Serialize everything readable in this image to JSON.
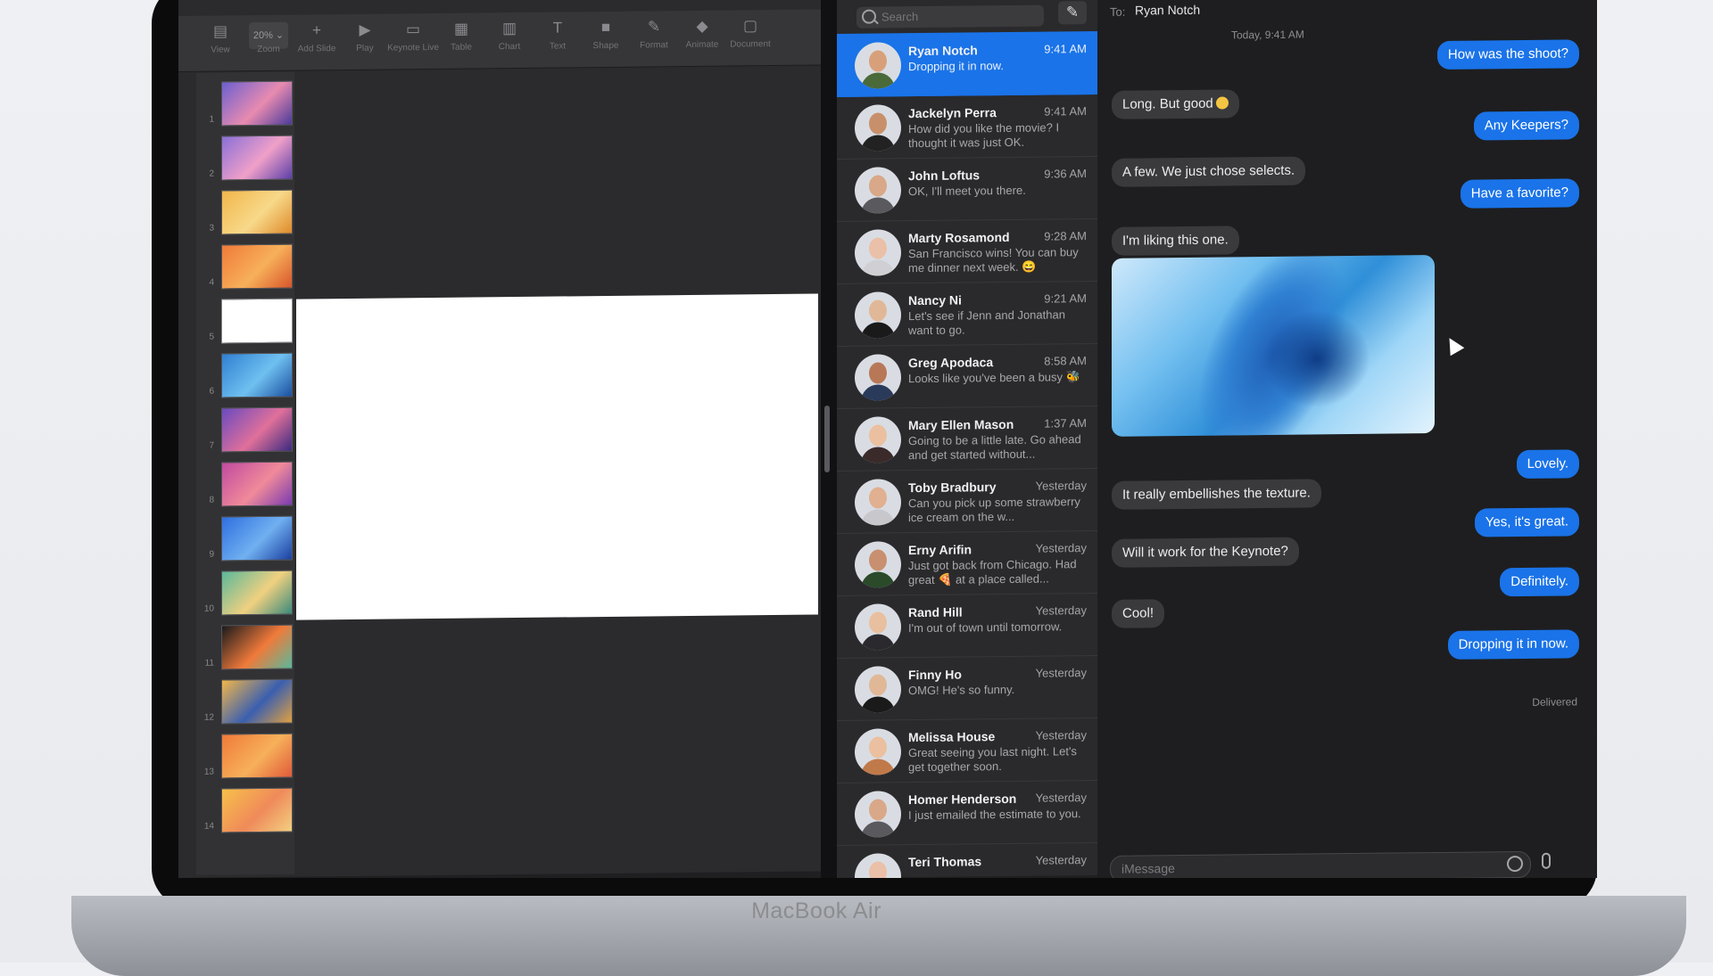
{
  "device": {
    "brand_label": "MacBook Air"
  },
  "keynote": {
    "toolbar": [
      {
        "label": "View",
        "icon": "sidebar-icon"
      },
      {
        "label": "Zoom",
        "icon": "zoom-icon",
        "value": "20%"
      },
      {
        "label": "Add Slide",
        "icon": "plus-icon"
      },
      {
        "label": "Play",
        "icon": "play-icon"
      },
      {
        "label": "Keynote Live",
        "icon": "live-icon"
      },
      {
        "label": "Table",
        "icon": "table-icon"
      },
      {
        "label": "Chart",
        "icon": "chart-icon"
      },
      {
        "label": "Text",
        "icon": "text-icon"
      },
      {
        "label": "Shape",
        "icon": "shape-icon"
      },
      {
        "label": "Format",
        "icon": "format-icon"
      },
      {
        "label": "Animate",
        "icon": "animate-icon"
      },
      {
        "label": "Document",
        "icon": "document-icon"
      }
    ],
    "slides": [
      {
        "num": "1",
        "colors": [
          "#6b5fd0",
          "#e88bb0",
          "#4a3a9a"
        ]
      },
      {
        "num": "2",
        "colors": [
          "#8a6fd8",
          "#f0a0c8",
          "#5b3fa8"
        ]
      },
      {
        "num": "3",
        "colors": [
          "#f2b64a",
          "#f7d98a",
          "#e08a2a"
        ]
      },
      {
        "num": "4",
        "colors": [
          "#f07a3a",
          "#f7b05a",
          "#d8552a"
        ]
      },
      {
        "num": "5",
        "colors": [
          "#ffffff",
          "#ffffff",
          "#ffffff"
        ]
      },
      {
        "num": "6",
        "colors": [
          "#2f7fd2",
          "#6fc0f0",
          "#1a4fa0"
        ]
      },
      {
        "num": "7",
        "colors": [
          "#6a4ac0",
          "#e0709a",
          "#3a2a80"
        ]
      },
      {
        "num": "8",
        "colors": [
          "#c04aa0",
          "#f08a9a",
          "#7a3ab0"
        ]
      },
      {
        "num": "9",
        "colors": [
          "#2f6fe0",
          "#70b0f0",
          "#1a3fa0"
        ]
      },
      {
        "num": "10",
        "colors": [
          "#5ab89a",
          "#f0d080",
          "#3a8a7a"
        ]
      },
      {
        "num": "11",
        "colors": [
          "#1a1a1c",
          "#f07a3a",
          "#5ab89a"
        ]
      },
      {
        "num": "12",
        "colors": [
          "#f2b64a",
          "#3a5fb0",
          "#e0a040"
        ]
      },
      {
        "num": "13",
        "colors": [
          "#f07a3a",
          "#f7b05a",
          "#e05a3a"
        ]
      },
      {
        "num": "14",
        "colors": [
          "#f7c04a",
          "#f08a5a",
          "#f2d080"
        ]
      }
    ]
  },
  "messages": {
    "search_placeholder": "Search",
    "compose_icon": "compose-icon",
    "conversations": [
      {
        "name": "Ryan Notch",
        "time": "9:41 AM",
        "preview": "Dropping it in now.",
        "skin": "#d8a07a",
        "shirt": "#4a6a3a",
        "selected": true
      },
      {
        "name": "Jackelyn Perra",
        "time": "9:41 AM",
        "preview": "How did you like the movie? I thought it was just OK.",
        "skin": "#c8906a",
        "shirt": "#222222"
      },
      {
        "name": "John Loftus",
        "time": "9:36 AM",
        "preview": "OK, I'll meet you there.",
        "skin": "#d8a888",
        "shirt": "#5a5a5e"
      },
      {
        "name": "Marty Rosamond",
        "time": "9:28 AM",
        "preview": "San Francisco wins! You can buy me dinner next week. 😄",
        "skin": "#eac0a8",
        "shirt": "#d0d0d4"
      },
      {
        "name": "Nancy Ni",
        "time": "9:21 AM",
        "preview": "Let's see if Jenn and Jonathan want to go.",
        "skin": "#e0b898",
        "shirt": "#1a1a1a"
      },
      {
        "name": "Greg Apodaca",
        "time": "8:58 AM",
        "preview": "Looks like you've been a busy 🐝",
        "skin": "#b87858",
        "shirt": "#2a3a5a"
      },
      {
        "name": "Mary Ellen Mason",
        "time": "1:37 AM",
        "preview": "Going to be a little late. Go ahead and get started without...",
        "skin": "#eac0a0",
        "shirt": "#3a2a2a"
      },
      {
        "name": "Toby Bradbury",
        "time": "Yesterday",
        "preview": "Can you pick up some strawberry ice cream on the w...",
        "skin": "#e0b090",
        "shirt": "#c8c8cc"
      },
      {
        "name": "Erny Arifin",
        "time": "Yesterday",
        "preview": "Just got back from Chicago. Had great 🍕 at a place called...",
        "skin": "#c89070",
        "shirt": "#2a4a2a"
      },
      {
        "name": "Rand Hill",
        "time": "Yesterday",
        "preview": "I'm out of town until tomorrow.",
        "skin": "#e8c0a0",
        "shirt": "#2a2a2e"
      },
      {
        "name": "Finny Ho",
        "time": "Yesterday",
        "preview": "OMG! He's so funny.",
        "skin": "#e0b898",
        "shirt": "#1a1a1a"
      },
      {
        "name": "Melissa House",
        "time": "Yesterday",
        "preview": "Great seeing you last night. Let's get together soon.",
        "skin": "#eac0a0",
        "shirt": "#c07a4a"
      },
      {
        "name": "Homer Henderson",
        "time": "Yesterday",
        "preview": "I just emailed the estimate to you.",
        "skin": "#d8a888",
        "shirt": "#5a5a5e"
      },
      {
        "name": "Teri Thomas",
        "time": "Yesterday",
        "preview": "",
        "skin": "#eac0a8",
        "shirt": "#8a8a8e"
      }
    ]
  },
  "chat": {
    "to_label": "To:",
    "recipient": "Ryan Notch",
    "date_label": "Today, 9:41 AM",
    "messages": [
      {
        "dir": "out",
        "text": "How was the shoot?"
      },
      {
        "dir": "in",
        "text": "Long. But good",
        "emoji": true
      },
      {
        "dir": "out",
        "text": "Any Keepers?"
      },
      {
        "dir": "in",
        "text": "A few. We just chose selects."
      },
      {
        "dir": "out",
        "text": "Have a favorite?"
      },
      {
        "dir": "in",
        "text": "I'm liking this one."
      },
      {
        "dir": "out",
        "text": "Lovely."
      },
      {
        "dir": "in",
        "text": "It really embellishes the texture."
      },
      {
        "dir": "out",
        "text": "Yes, it's great."
      },
      {
        "dir": "in",
        "text": "Will it work for the Keynote?"
      },
      {
        "dir": "out",
        "text": "Definitely."
      },
      {
        "dir": "in",
        "text": "Cool!"
      },
      {
        "dir": "out",
        "text": "Dropping it in now."
      }
    ],
    "delivered": "Delivered",
    "composer_placeholder": "iMessage",
    "emoji_icon": "emoji-icon",
    "mic_icon": "mic-icon"
  }
}
